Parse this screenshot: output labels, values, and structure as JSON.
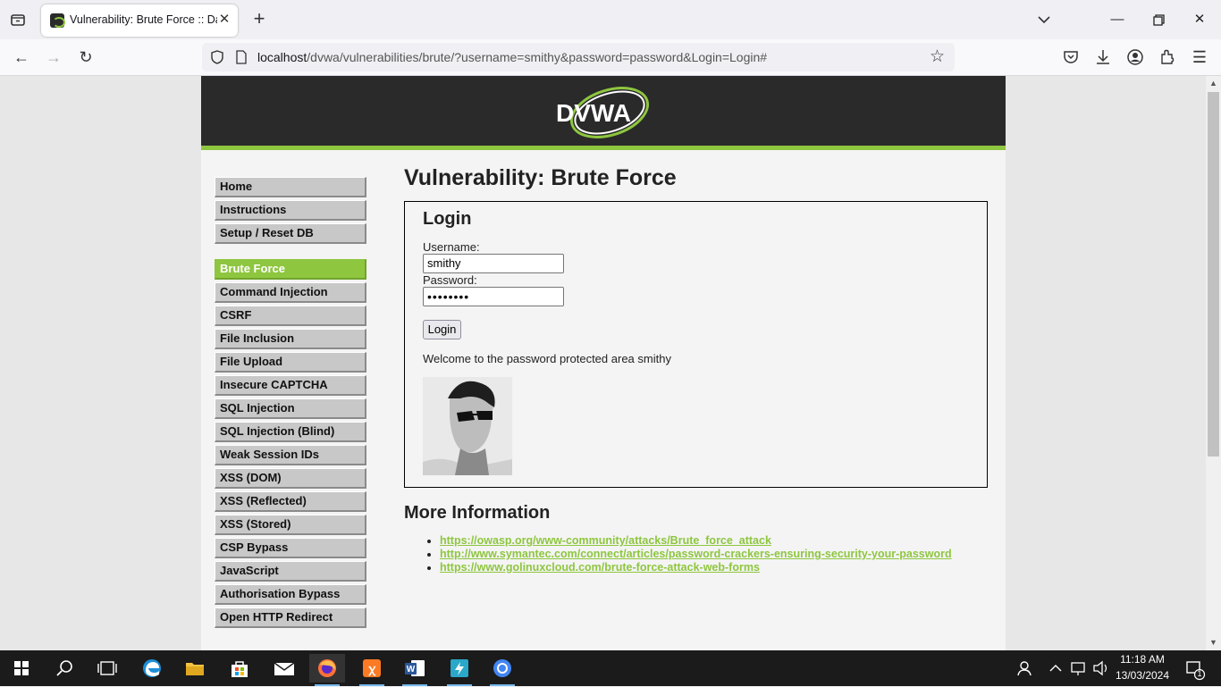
{
  "browser": {
    "tab_title": "Vulnerability: Brute Force :: Damn Vulnerable Web Application (DVWA)",
    "url_host": "localhost",
    "url_path": "/dvwa/vulnerabilities/brute/?username=smithy&password=password&Login=Login#"
  },
  "header": {
    "logo_text": "DVWA"
  },
  "menu": {
    "block1": [
      "Home",
      "Instructions",
      "Setup / Reset DB"
    ],
    "block2": [
      "Brute Force",
      "Command Injection",
      "CSRF",
      "File Inclusion",
      "File Upload",
      "Insecure CAPTCHA",
      "SQL Injection",
      "SQL Injection (Blind)",
      "Weak Session IDs",
      "XSS (DOM)",
      "XSS (Reflected)",
      "XSS (Stored)",
      "CSP Bypass",
      "JavaScript",
      "Authorisation Bypass",
      "Open HTTP Redirect"
    ],
    "selected": "Brute Force"
  },
  "main": {
    "title": "Vulnerability: Brute Force",
    "login_heading": "Login",
    "username_label": "Username:",
    "username_value": "smithy",
    "password_label": "Password:",
    "password_value": "••••••••",
    "login_button": "Login",
    "welcome_message": "Welcome to the password protected area smithy",
    "more_info_title": "More Information",
    "links": [
      "https://owasp.org/www-community/attacks/Brute_force_attack",
      "http://www.symantec.com/connect/articles/password-crackers-ensuring-security-your-password",
      "https://www.golinuxcloud.com/brute-force-attack-web-forms"
    ]
  },
  "taskbar": {
    "time": "11:18 AM",
    "date": "13/03/2024",
    "notification_count": "1"
  },
  "colors": {
    "accent": "#8ec63f",
    "header_bg": "#2a2a2a",
    "menu_bg": "#c8c8c8"
  }
}
